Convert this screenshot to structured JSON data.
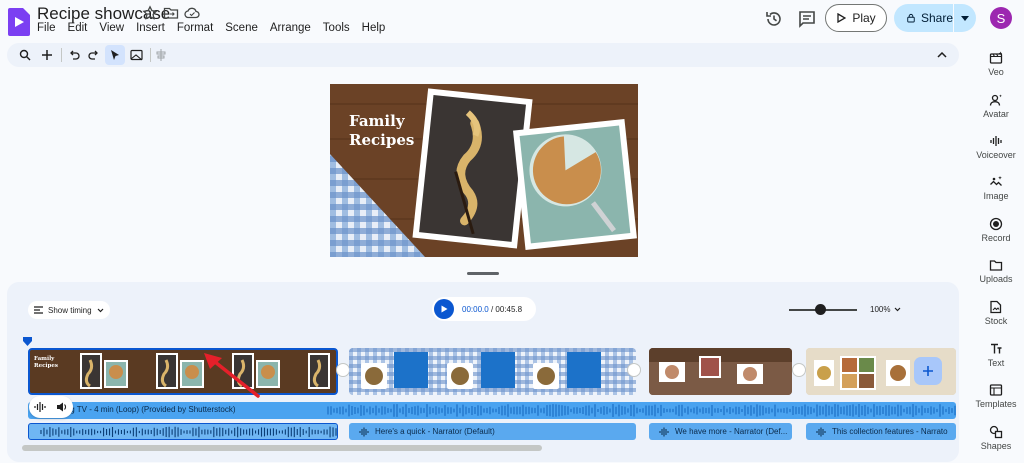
{
  "header": {
    "title": "Recipe showcase",
    "menu": [
      "File",
      "Edit",
      "View",
      "Insert",
      "Format",
      "Scene",
      "Arrange",
      "Tools",
      "Help"
    ],
    "play_label": "Play",
    "share_label": "Share",
    "avatar_initial": "S"
  },
  "toolbar": {
    "icons": [
      "search-icon",
      "add-icon",
      "undo-icon",
      "redo-icon",
      "select-icon",
      "background-icon",
      "align-icon",
      "collapse-icon"
    ]
  },
  "right_panel": {
    "items": [
      {
        "label": "Veo",
        "icon": "veo-icon"
      },
      {
        "label": "Avatar",
        "icon": "avatar-icon"
      },
      {
        "label": "Voiceover",
        "icon": "voiceover-icon"
      },
      {
        "label": "Image",
        "icon": "image-icon"
      },
      {
        "label": "Record",
        "icon": "record-icon"
      },
      {
        "label": "Uploads",
        "icon": "folder-icon"
      },
      {
        "label": "Stock",
        "icon": "stock-icon"
      },
      {
        "label": "Text",
        "icon": "text-icon"
      },
      {
        "label": "Templates",
        "icon": "templates-icon"
      },
      {
        "label": "Shapes",
        "icon": "shapes-icon"
      }
    ]
  },
  "slide": {
    "title": "Family\nRecipes"
  },
  "timeline": {
    "show_timing_label": "Show timing",
    "current_time": "00:00.0",
    "total_time": "/ 00:45.8",
    "zoom": "100%",
    "zoom_fraction": 0.4,
    "music_label": "king TV - 4 min (Loop) (Provided by Shutterstock)",
    "narrations": [
      "",
      "Here's a quick - Narrator (Default)",
      "We have more - Narrator (Def...",
      "This collection features - Narrato"
    ],
    "thumb_text": "Family Recipes"
  },
  "colors": {
    "accent": "#0b57d0",
    "share_bg": "#c2e7ff",
    "avatar_bg": "#9c27b0",
    "audio_track": "#4aa3f0"
  }
}
